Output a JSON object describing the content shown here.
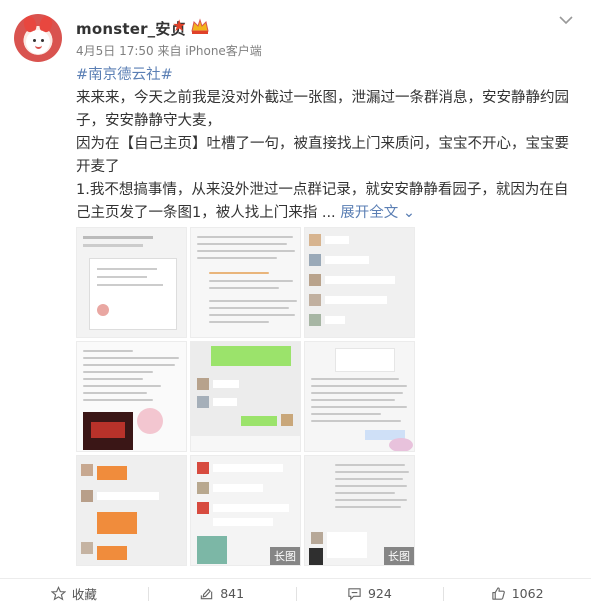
{
  "post": {
    "username": "monster_安贞",
    "meta": "4月5日 17:50 来自 iPhone客户端",
    "hashtag": "#南京德云社#",
    "paragraphs": [
      "来来来，今天之前我是没对外截过一张图，泄漏过一条群消息，安安静静约园子，安安静静守大麦，",
      "因为在【自己主页】吐槽了一句，被直接找上门来质问，宝宝不开心，宝宝要开麦了"
    ],
    "truncated_text": "1.我不想搞事情，从来没外泄过一点群记录，就安安静静看园子，就因为在自己主页发了一条图1，被人找上门来指 ...",
    "expand_label": "展开全文",
    "long_image_badge": "长图"
  },
  "images": [
    {
      "name": "image-1"
    },
    {
      "name": "image-2"
    },
    {
      "name": "image-3"
    },
    {
      "name": "image-4"
    },
    {
      "name": "image-5"
    },
    {
      "name": "image-6"
    },
    {
      "name": "image-7"
    },
    {
      "name": "image-8"
    },
    {
      "name": "image-9"
    }
  ],
  "footer": {
    "favorite_label": "收藏",
    "repost_count": "841",
    "comment_count": "924",
    "like_count": "1062"
  },
  "icons": {
    "star": "star-icon",
    "crown": "crown-icon",
    "chevron": "chevron-down-icon",
    "favorite": "favorite-icon",
    "repost": "repost-icon",
    "comment": "comment-icon",
    "like": "like-icon"
  },
  "colors": {
    "link": "#5b7fb4",
    "star": "#e0412a",
    "badge_bg": "rgba(0,0,0,0.45)"
  }
}
